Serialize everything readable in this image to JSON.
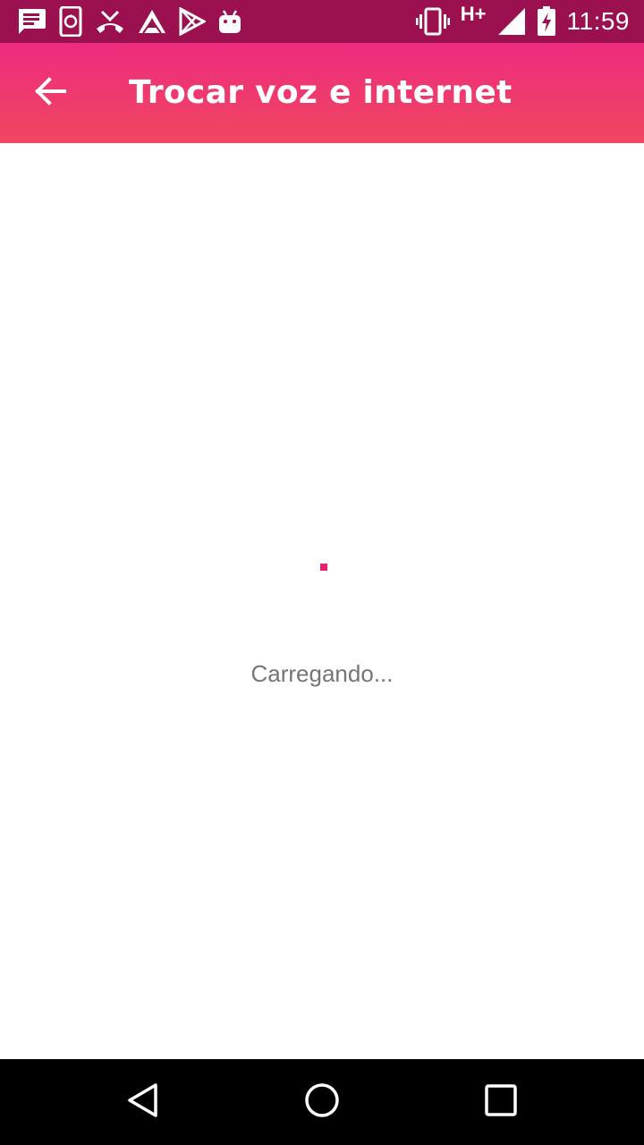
{
  "status_bar": {
    "left_icons": [
      "message-icon",
      "phone-sync-icon",
      "missed-call-icon",
      "triangle-app-icon",
      "play-store-icon",
      "android-icon"
    ],
    "right_icons": [
      "vibrate-icon",
      "signal-icon",
      "battery-charging-icon"
    ],
    "network_type": "H+",
    "time": "11:59",
    "background": "#9b1150"
  },
  "app_bar": {
    "title": "Trocar voz e internet",
    "back_icon": "arrow-back-icon",
    "gradient": [
      "#ee2b7e",
      "#ef4760"
    ]
  },
  "content": {
    "loading_text": "Carregando...",
    "spinner_color": "#e0246f"
  },
  "nav_bar": {
    "buttons": [
      "back-triangle-icon",
      "home-circle-icon",
      "recents-square-icon"
    ]
  }
}
